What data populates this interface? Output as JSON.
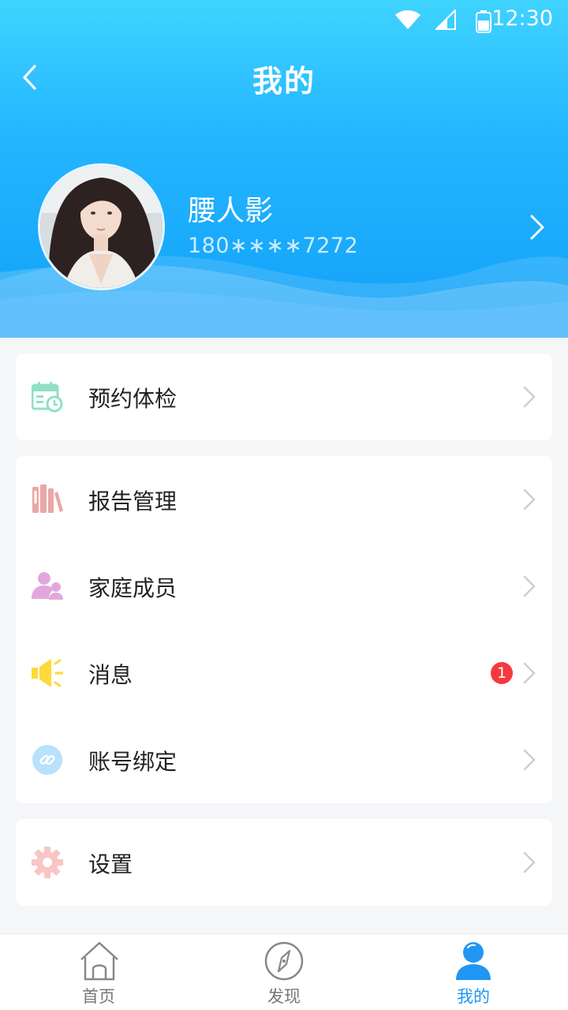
{
  "status_bar": {
    "time": "12:30"
  },
  "header": {
    "title": "我的",
    "back_icon": "chevron-left-icon"
  },
  "profile": {
    "name": "腰人影",
    "phone": "180∗∗∗∗7272",
    "arrow_icon": "chevron-right-icon"
  },
  "menu": {
    "booking": {
      "label": "预约体检",
      "icon": "calendar-clock-icon",
      "icon_color": "#8fe0c6"
    },
    "reports": {
      "label": "报告管理",
      "icon": "books-icon",
      "icon_color": "#e9a7a7"
    },
    "family": {
      "label": "家庭成员",
      "icon": "family-members-icon",
      "icon_color": "#e2a8dc"
    },
    "messages": {
      "label": "消息",
      "icon": "speaker-icon",
      "icon_color": "#ffd83a",
      "badge": "1",
      "badge_color": "#f4393c"
    },
    "account_binding": {
      "label": "账号绑定",
      "icon": "link-icon",
      "icon_color": "#b8e2fb"
    },
    "settings": {
      "label": "设置",
      "icon": "gear-icon",
      "icon_color": "#f9c5c5"
    }
  },
  "bottom_nav": {
    "items": [
      {
        "label": "首页",
        "icon": "home-icon",
        "active": false
      },
      {
        "label": "发现",
        "icon": "compass-icon",
        "active": false
      },
      {
        "label": "我的",
        "icon": "user-icon",
        "active": true
      }
    ],
    "active_color": "#2196f3"
  },
  "colors": {
    "header_top": "#3fd3ff",
    "header_bottom": "#12a0f8",
    "background": "#f5f6f8"
  }
}
